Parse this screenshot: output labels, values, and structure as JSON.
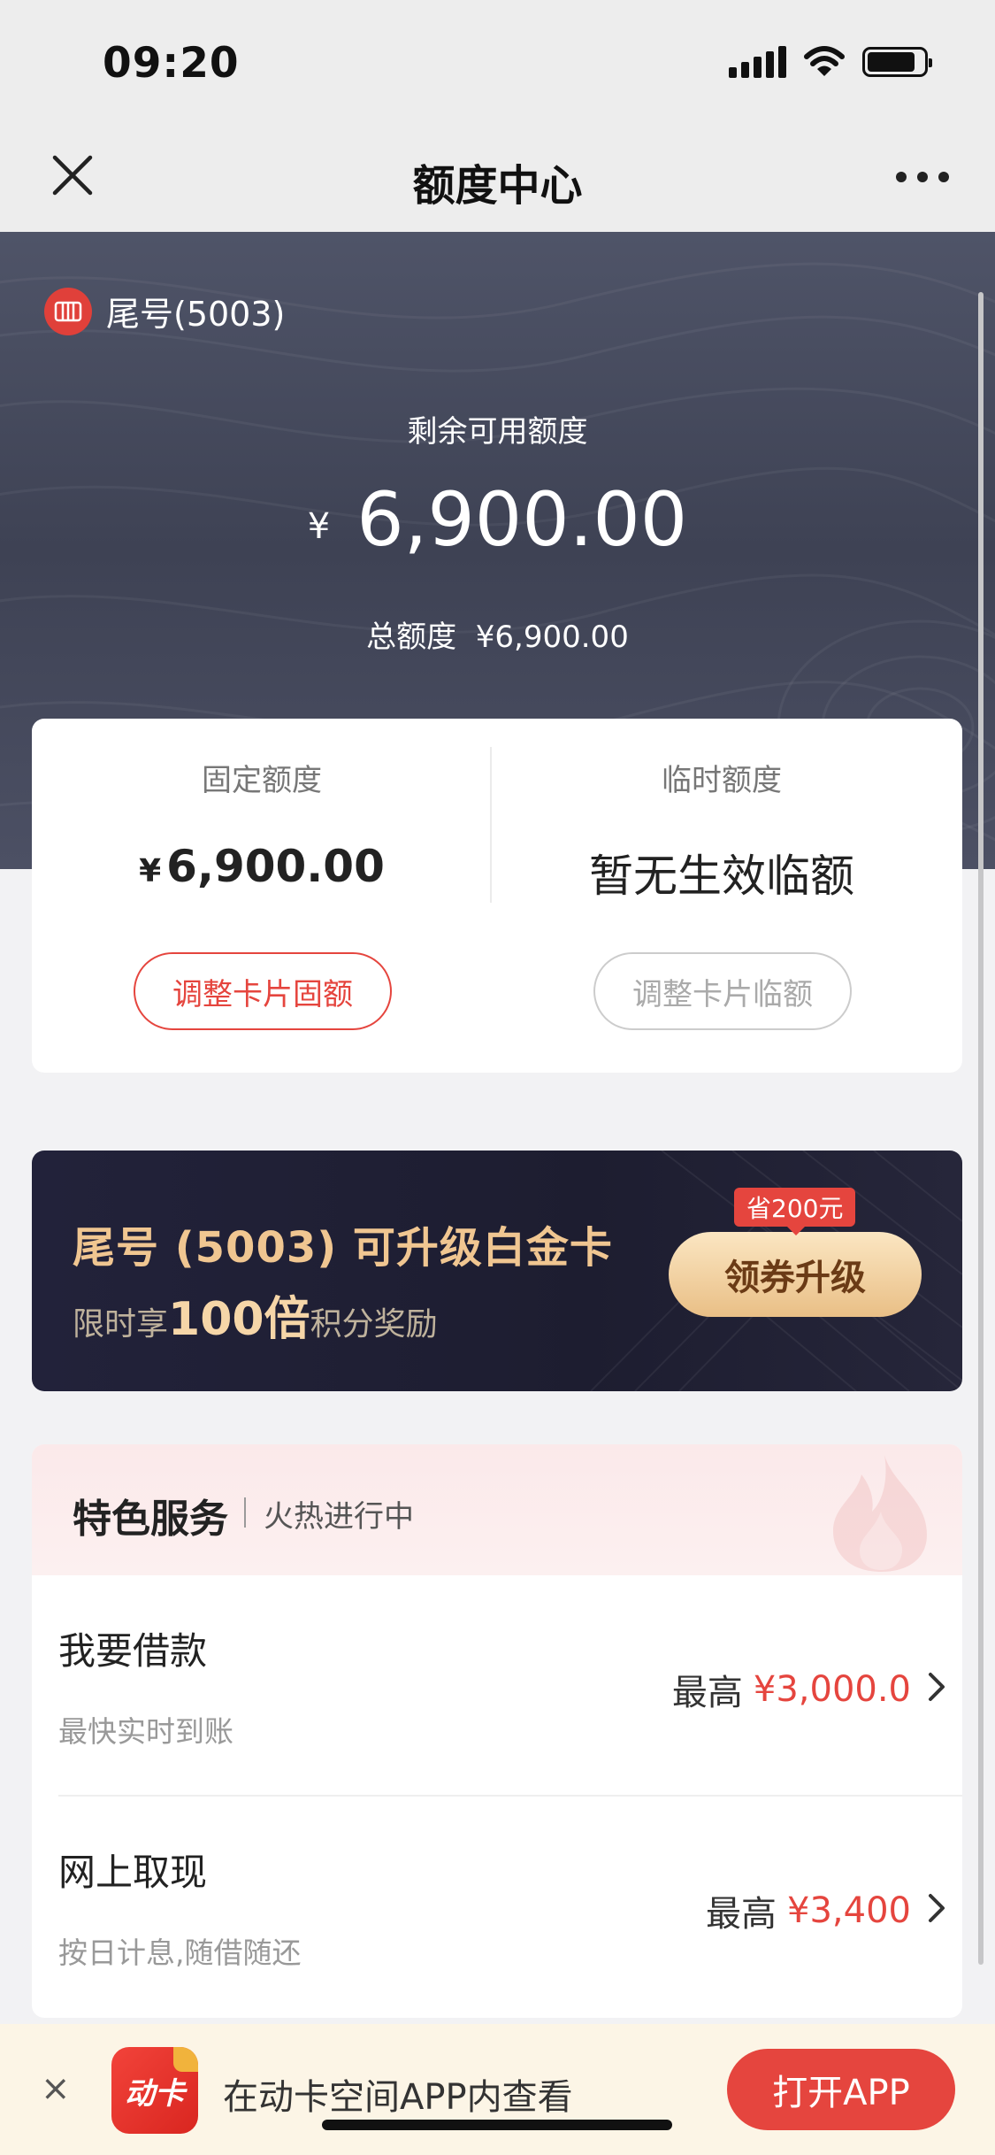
{
  "status_bar": {
    "time": "09:20",
    "signal_icon": "signal-icon",
    "wifi_icon": "wifi-icon",
    "battery_icon": "battery-icon",
    "battery_level": 0.85
  },
  "nav": {
    "title": "额度中心",
    "close_icon": "close-icon",
    "more_icon": "more-icon"
  },
  "hero": {
    "card_label": "尾号(5003)",
    "available_label": "剩余可用额度",
    "currency_symbol": "¥",
    "available_amount": "6,900.00",
    "total_label": "总额度",
    "total_amount": "¥6,900.00"
  },
  "quota": {
    "fixed": {
      "title": "固定额度",
      "currency": "¥",
      "value": "6,900.00",
      "button": "调整卡片固额"
    },
    "temp": {
      "title": "临时额度",
      "value": "暂无生效临额",
      "button": "调整卡片临额"
    }
  },
  "upgrade": {
    "title": "尾号 (5003) 可升级白金卡",
    "sub_prefix": "限时享",
    "sub_highlight": "100倍",
    "sub_suffix": "积分奖励",
    "badge": "省200元",
    "button": "领券升级"
  },
  "services": {
    "title": "特色服务",
    "subtitle": "火热进行中",
    "items": [
      {
        "name": "我要借款",
        "desc": "最快实时到账",
        "prefix": "最高",
        "amount": "¥3,000.0"
      },
      {
        "name": "网上取现",
        "desc": "按日计息,随借随还",
        "prefix": "最高",
        "amount": "¥3,400"
      }
    ]
  },
  "app_banner": {
    "close": "×",
    "logo_text": "动卡",
    "text": "在动卡空间APP内查看",
    "button": "打开APP"
  },
  "colors": {
    "accent_red": "#e5453e",
    "hero_bg": "#454a5e",
    "gold": "#f0c691"
  }
}
